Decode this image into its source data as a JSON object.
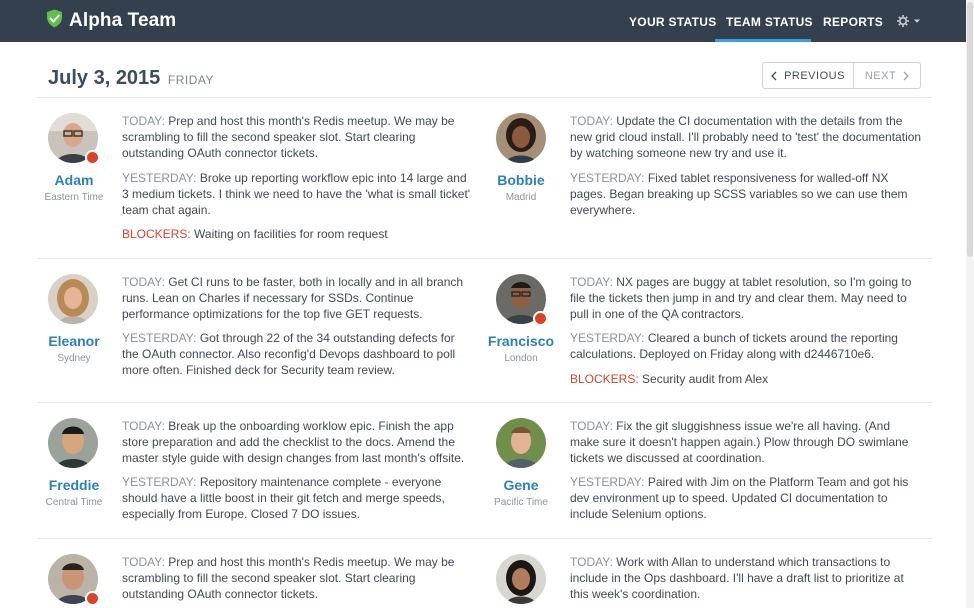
{
  "app": {
    "title": "Alpha Team"
  },
  "nav": {
    "your_status": "YOUR STATUS",
    "team_status": "TEAM STATUS",
    "reports": "REPORTS"
  },
  "page": {
    "date": "July 3, 2015",
    "day": "FRIDAY",
    "prev_label": "PREVIOUS",
    "next_label": "NEXT"
  },
  "labels": {
    "today": "TODAY:",
    "yesterday": "YESTERDAY:",
    "blockers": "BLOCKERS:"
  },
  "members": [
    {
      "name": "Adam",
      "location": "Eastern Time",
      "status_dot": true,
      "today": "Prep and host this month's Redis meetup. We may be scrambling to fill the second speaker slot. Start clearing outstanding OAuth connector tickets.",
      "yesterday": "Broke up reporting workflow epic into 14 large and 3 medium tickets. I think we need to have the 'what is small ticket' team chat again.",
      "blockers": "Waiting on facilities for room request"
    },
    {
      "name": "Bobbie",
      "location": "Madrid",
      "status_dot": false,
      "today": "Update the CI documentation with the details from the new grid cloud install. I'll probably need to 'test' the documentation by watching someone new try and use it.",
      "yesterday": "Fixed tablet responsiveness for walled-off NX pages. Began breaking up SCSS variables so we can use them everywhere."
    },
    {
      "name": "Eleanor",
      "location": "Sydney",
      "status_dot": false,
      "today": "Get CI runs to be faster, both in locally and in all branch runs. Lean on Charles if necessary for SSDs. Continue performance optimizations for the top five GET requests.",
      "yesterday": "Got through 22 of the 34 outstanding defects for the OAuth connector. Also reconfig'd Devops dashboard to poll more often. Finished deck for Security team review."
    },
    {
      "name": "Francisco",
      "location": "London",
      "status_dot": true,
      "today": "NX pages are buggy at tablet resolution, so I'm going to file the tickets then jump in and try and clear them. May need to pull in one of the QA contractors.",
      "yesterday": "Cleared a bunch of tickets around the reporting calculations. Deployed on Friday along with d2446710e6.",
      "blockers": "Security audit from Alex"
    },
    {
      "name": "Freddie",
      "location": "Central Time",
      "status_dot": false,
      "today": "Break up the onboarding worklow epic. Finish the app store preparation and add the checklist to the docs. Amend the master style guide with design changes from last month's offsite.",
      "yesterday": "Repository maintenance complete - everyone should have a little boost in their git fetch and merge speeds, especially from Europe. Closed 7 DO issues."
    },
    {
      "name": "Gene",
      "location": "Pacific Time",
      "status_dot": false,
      "today": "Fix the git sluggishness issue we're all having. (And make sure it doesn't happen again.) Plow through DO swimlane tickets we discussed at coordination.",
      "yesterday": "Paired with Jim on the Platform Team and got his dev environment up to speed. Updated CI documentation to include Selenium options."
    },
    {
      "name": "",
      "location": "",
      "status_dot": true,
      "today": "Prep and host this month's Redis meetup. We may be scrambling to fill the second speaker slot. Start clearing outstanding OAuth connector tickets."
    },
    {
      "name": "",
      "location": "",
      "status_dot": false,
      "today": "Work with Allan to understand which transactions to include in the Ops dashboard. I'll have a draft list to prioritize at this week's coordination."
    }
  ],
  "colors": {
    "topbar": "#34404d",
    "accent": "#3aa0dc",
    "name": "#2c7fc3",
    "blocker": "#d9422b",
    "status_dot": "#d9422b"
  },
  "icons": [
    "shield-check-icon",
    "gear-icon",
    "caret-down-icon",
    "chevron-left-icon",
    "chevron-right-icon"
  ]
}
